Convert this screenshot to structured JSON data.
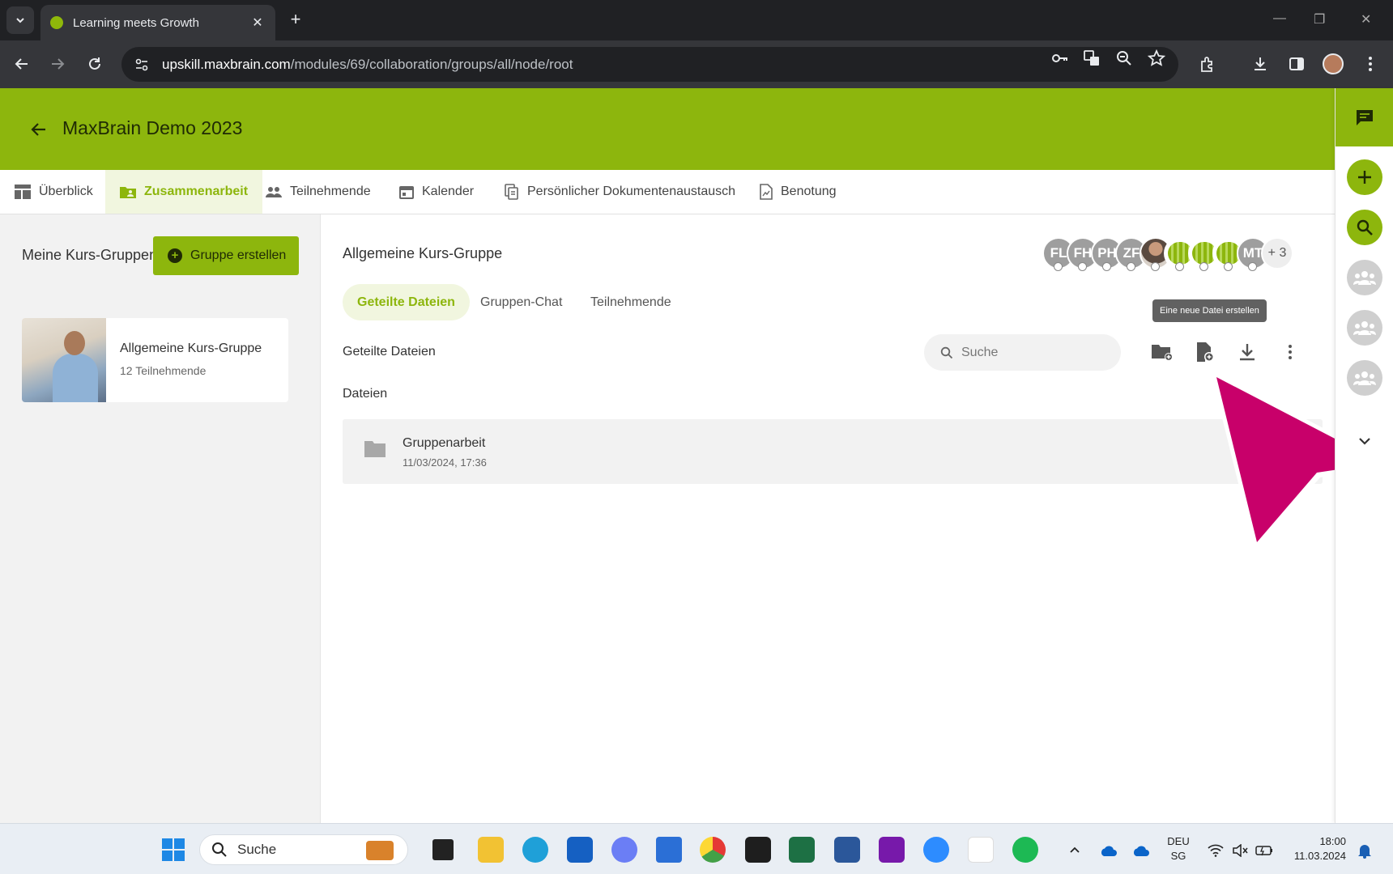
{
  "browser": {
    "tab_title": "Learning meets Growth",
    "url_host": "upskill.maxbrain.com",
    "url_path": "/modules/69/collaboration/groups/all/node/root"
  },
  "header": {
    "course_title": "MaxBrain Demo 2023"
  },
  "nav_tabs": [
    {
      "label": "Überblick",
      "icon": "dashboard-icon"
    },
    {
      "label": "Zusammenarbeit",
      "icon": "folder-shared-icon",
      "active": true
    },
    {
      "label": "Teilnehmende",
      "icon": "people-icon"
    },
    {
      "label": "Kalender",
      "icon": "calendar-icon"
    },
    {
      "label": "Persönlicher Dokumentenaustausch",
      "icon": "documents-icon"
    },
    {
      "label": "Benotung",
      "icon": "grading-icon"
    }
  ],
  "left_panel": {
    "title": "Meine Kurs-Gruppen",
    "create_button": "Gruppe erstellen",
    "groups": [
      {
        "name": "Allgemeine Kurs-Gruppe",
        "members": "12 Teilnehmende"
      }
    ]
  },
  "main": {
    "group_title": "Allgemeine Kurs-Gruppe",
    "avatars": [
      "FL",
      "FH",
      "PH",
      "ZF",
      "",
      "",
      "",
      "",
      "MT",
      "+ 3"
    ],
    "subtabs": [
      {
        "label": "Geteilte Dateien",
        "active": true
      },
      {
        "label": "Gruppen-Chat"
      },
      {
        "label": "Teilnehmende"
      }
    ],
    "section_label": "Geteilte Dateien",
    "search_placeholder": "Suche",
    "tooltip": "Eine neue Datei erstellen",
    "files_label": "Dateien",
    "files": [
      {
        "name": "Gruppenarbeit",
        "date": "11/03/2024, 17:36",
        "icon": "folder-icon"
      }
    ]
  },
  "taskbar": {
    "search": "Suche",
    "language": "DEU",
    "region": "SG",
    "time": "18:00",
    "date": "11.03.2024"
  },
  "colors": {
    "brand_green": "#8db60d",
    "pointer_pink": "#c8006a"
  }
}
